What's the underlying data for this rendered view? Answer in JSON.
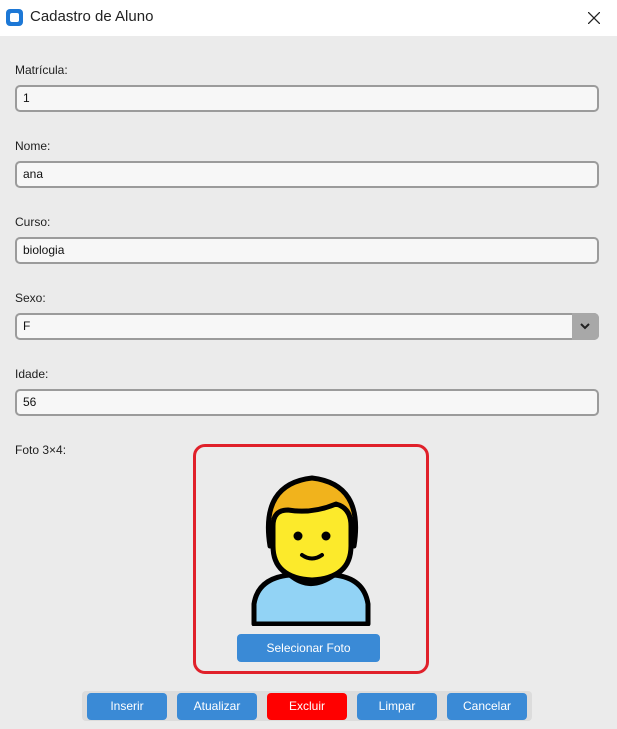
{
  "window": {
    "title": "Cadastro de Aluno",
    "app_icon": "app-icon",
    "close_icon": "close-icon"
  },
  "form": {
    "matricula": {
      "label": "Matrícula:",
      "value": "1"
    },
    "nome": {
      "label": "Nome:",
      "value": "ana"
    },
    "curso": {
      "label": "Curso:",
      "value": "biologia"
    },
    "sexo": {
      "label": "Sexo:",
      "value": "F",
      "icon": "chevron-down-icon"
    },
    "idade": {
      "label": "Idade:",
      "value": "56"
    },
    "foto": {
      "label": "Foto 3×4:",
      "button": "Selecionar Foto",
      "image": "person-avatar"
    }
  },
  "buttons": {
    "inserir": "Inserir",
    "atualizar": "Atualizar",
    "excluir": "Excluir",
    "limpar": "Limpar",
    "cancelar": "Cancelar"
  },
  "colors": {
    "primary_button": "#3a8ad6",
    "danger_button": "#ff0000",
    "photo_frame_border": "#e0202a",
    "avatar_hair": "#f1b31c",
    "avatar_face": "#fcea2b",
    "avatar_shirt": "#92d3f5"
  }
}
